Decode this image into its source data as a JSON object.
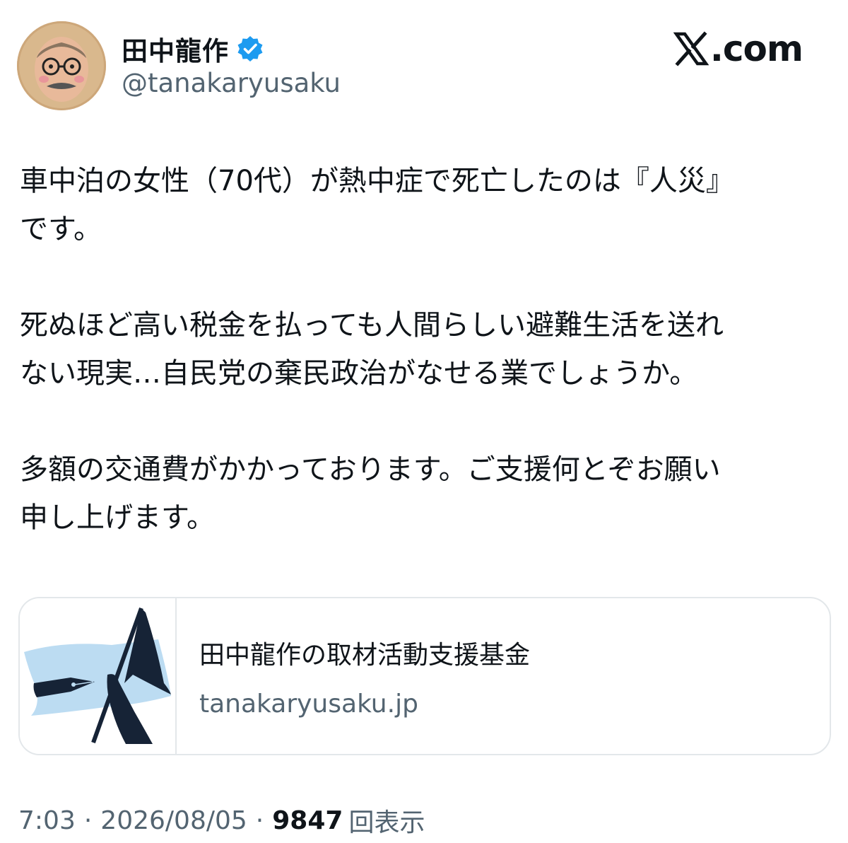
{
  "author": {
    "display_name": "田中龍作",
    "handle": "@tanakaryusaku",
    "verified_icon": "verified-badge-icon"
  },
  "brand": {
    "logo_label": ".com"
  },
  "tweet": {
    "paragraphs": [
      [
        "車中泊の女性（70代）が熱中症で死亡したのは『人災』",
        "です。"
      ],
      [
        "死ぬほど高い税金を払っても人間らしい避難生活を送れ",
        "ない現実…自民党の棄民政治がなせる業でしょうか。"
      ],
      [
        "多額の交通費がかかっております。ご支援何とぞお願い",
        "申し上げます。"
      ]
    ]
  },
  "card": {
    "title": "田中龍作の取材活動支援基金",
    "domain": "tanakaryusaku.jp"
  },
  "meta": {
    "time": "7:03",
    "date": "2026/08/05",
    "views_count": "9847",
    "views_label": "回表示",
    "separator": "·"
  },
  "colors": {
    "verified": "#1d9bf0",
    "text": "#0f1419",
    "muted": "#536471",
    "border": "#e3e7ea"
  }
}
